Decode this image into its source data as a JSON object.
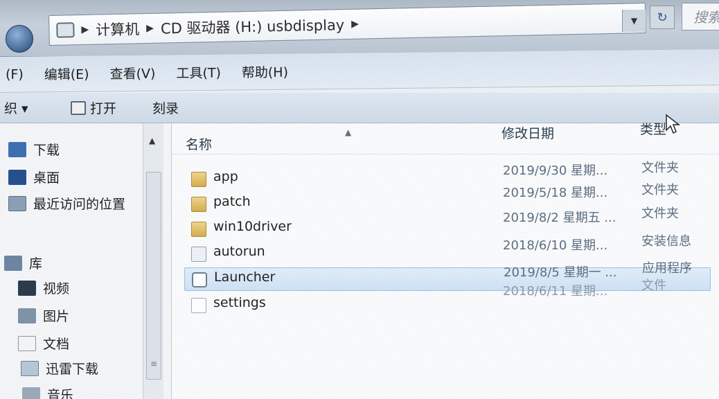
{
  "address_bar": {
    "crumbs": [
      "计算机",
      "CD 驱动器 (H:) usbdisplay"
    ],
    "search_placeholder": "搜索"
  },
  "menu": [
    "(F)",
    "编辑(E)",
    "查看(V)",
    "工具(T)",
    "帮助(H)"
  ],
  "toolbar": {
    "organize": "织 ▾",
    "open": "打开",
    "burn": "刻录"
  },
  "nav": {
    "favorites": [
      "下载",
      "桌面",
      "最近访问的位置"
    ],
    "library_label": "库",
    "libraries": [
      "视频",
      "图片",
      "文档",
      "迅雷下载",
      "音乐"
    ]
  },
  "columns": {
    "name": "名称",
    "date": "修改日期",
    "type": "类型"
  },
  "files": [
    {
      "name": "app",
      "date": "2019/9/30 星期...",
      "type": "文件夹",
      "icon": "folder-icon"
    },
    {
      "name": "patch",
      "date": "2019/5/18 星期...",
      "type": "文件夹",
      "icon": "folder-icon"
    },
    {
      "name": "win10driver",
      "date": "2019/8/2 星期五 ...",
      "type": "文件夹",
      "icon": "folder-icon"
    },
    {
      "name": "autorun",
      "date": "2018/6/10 星期...",
      "type": "安装信息",
      "icon": "setup-info-icon"
    },
    {
      "name": "Launcher",
      "date": "2019/8/5 星期一 ...",
      "type": "应用程序",
      "icon": "application-icon",
      "selected": true
    },
    {
      "name": "settings",
      "date": "2018/6/11 星期...",
      "type": "文件",
      "icon": "file-icon"
    }
  ],
  "colors": {
    "selection_bg": "#cfe2f6",
    "selection_border": "#9cc0e6",
    "folder": "#d5ac4c",
    "address_bar": "#b9c5d2"
  }
}
